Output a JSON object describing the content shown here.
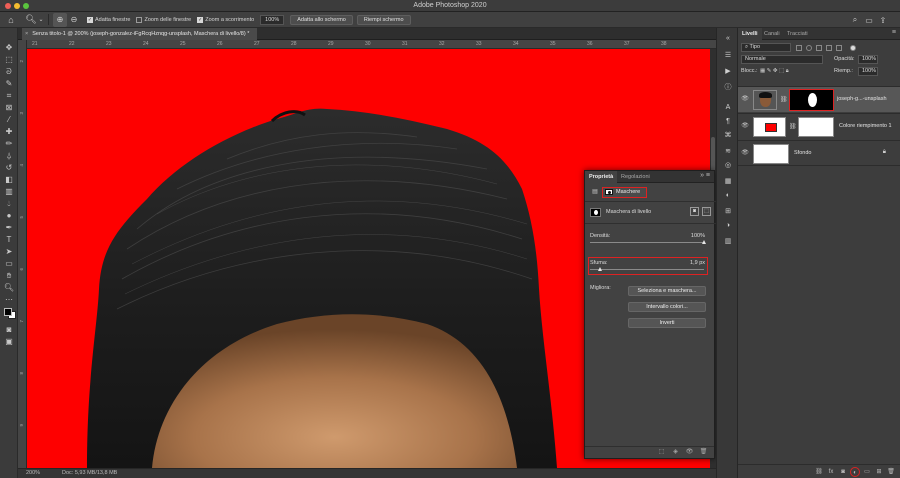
{
  "app_title": "Adobe Photoshop 2020",
  "options_bar": {
    "home_icon": "home-icon",
    "zoom_tool_icon": "zoom-tool-icon",
    "zoom_in_icon": "zoom-in-icon",
    "zoom_out_icon": "zoom-out-icon",
    "fit_windows_label": "Adatta finestre",
    "fit_windows_checked": true,
    "zoom_all_windows_label": "Zoom delle finestre",
    "zoom_all_windows_checked": false,
    "scrubby_zoom_label": "Zoom a scorrimento",
    "scrubby_zoom_checked": true,
    "zoom_value": "100%",
    "fit_screen_label": "Adatta allo schermo",
    "fill_screen_label": "Riempi schermo"
  },
  "document": {
    "tab_title": "Senza titolo-1 @ 200% (joseph-gonzalez-iFgRcqHznqg-unsplash, Maschera di livello/8) *",
    "ruler_top": [
      "21",
      "22",
      "23",
      "24",
      "25",
      "26",
      "27",
      "28",
      "29",
      "30",
      "31",
      "32",
      "33",
      "34",
      "35",
      "36",
      "37",
      "38"
    ],
    "ruler_left": [
      "2",
      "3",
      "4",
      "5",
      "6",
      "7",
      "8",
      "9"
    ],
    "background_color": "#fe0000"
  },
  "status_bar": {
    "zoom": "200%",
    "doc_info": "Doc: 5,93 MB/13,8 MB"
  },
  "properties_panel": {
    "tab_active": "Proprietà",
    "tab_inactive": "Regolazioni",
    "mask_section_label": "Maschere",
    "layer_mask_label": "Maschera di livello",
    "density_label": "Densità:",
    "density_value": "100%",
    "density_fraction": 1.0,
    "feather_label": "Sfuma:",
    "feather_value": "1,9 px",
    "feather_fraction": 0.02,
    "refine_label": "Migliora:",
    "select_and_mask_label": "Seleziona e maschera...",
    "color_range_label": "Intervallo colori...",
    "invert_label": "Inverti"
  },
  "layers_panel": {
    "tabs": [
      "Livelli",
      "Canali",
      "Tracciati"
    ],
    "filter_kind": "Tipo",
    "blend_mode": "Normale",
    "opacity_label": "Opacità:",
    "opacity_value": "100%",
    "lock_label": "Blocc.:",
    "fill_label": "Riemp.:",
    "fill_value": "100%",
    "layers": [
      {
        "name": "joseph-g...-unsplash",
        "visible": true,
        "selected": true
      },
      {
        "name": "Colore riempimento 1",
        "visible": true,
        "selected": false
      },
      {
        "name": "Sfondo",
        "visible": true,
        "selected": false,
        "locked": true
      }
    ]
  }
}
